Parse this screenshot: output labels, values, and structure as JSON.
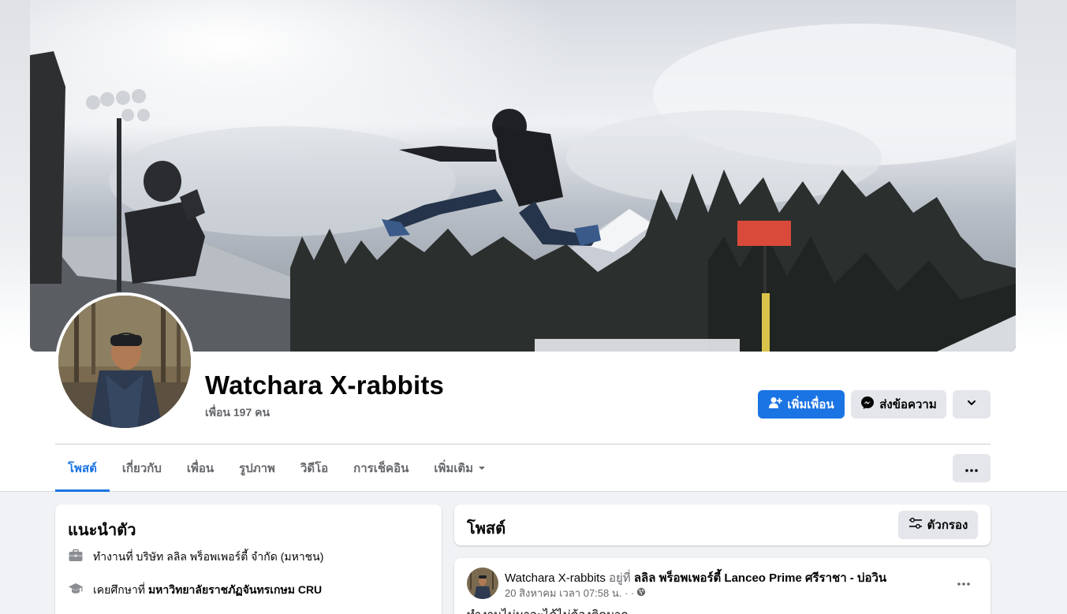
{
  "profile": {
    "name": "Watchara X-rabbits",
    "friends": "เพื่อน 197 คน"
  },
  "actions": {
    "add_friend": "เพิ่มเพื่อน",
    "message": "ส่งข้อความ"
  },
  "tabs": [
    {
      "label": "โพสต์"
    },
    {
      "label": "เกี่ยวกับ"
    },
    {
      "label": "เพื่อน"
    },
    {
      "label": "รูปภาพ"
    },
    {
      "label": "วิดีโอ"
    },
    {
      "label": "การเช็คอิน"
    },
    {
      "label": "เพิ่มเติม"
    }
  ],
  "intro": {
    "title": "แนะนำตัว",
    "work_prefix": "ทำงานที่ ",
    "work_value": "บริษัท ลลิล พร็อพเพอร์ตี้ จำกัด (มหาชน)",
    "edu_prefix": "เคยศึกษาที่ ",
    "edu_value": "มหาวิทยาลัยราชภัฏจันทรเกษม CRU"
  },
  "posts_header": {
    "title": "โพสต์",
    "filter": "ตัวกรอง"
  },
  "post": {
    "author": "Watchara X-rabbits",
    "at": "อยู่ที่",
    "place": "ลลิล พร็อพเพอร์ตี้ Lanceo Prime ศรีราชา - บ่อวิน",
    "date": "20 สิงหาคม เวลา 07:58 น. · ·",
    "text": "ทำงานไม่มาจะได้ไม่ต้องติดมาก"
  },
  "colors": {
    "accent": "#1b74e4",
    "secondary_button": "#e4e6eb",
    "muted_text": "#65676b",
    "page_bg": "#f0f2f5"
  },
  "icons": [
    "add-friend-icon",
    "messenger-icon",
    "chevron-down-icon",
    "more-icon",
    "briefcase-icon",
    "graduation-cap-icon",
    "filter-icon",
    "globe-icon",
    "caret-down-icon"
  ]
}
